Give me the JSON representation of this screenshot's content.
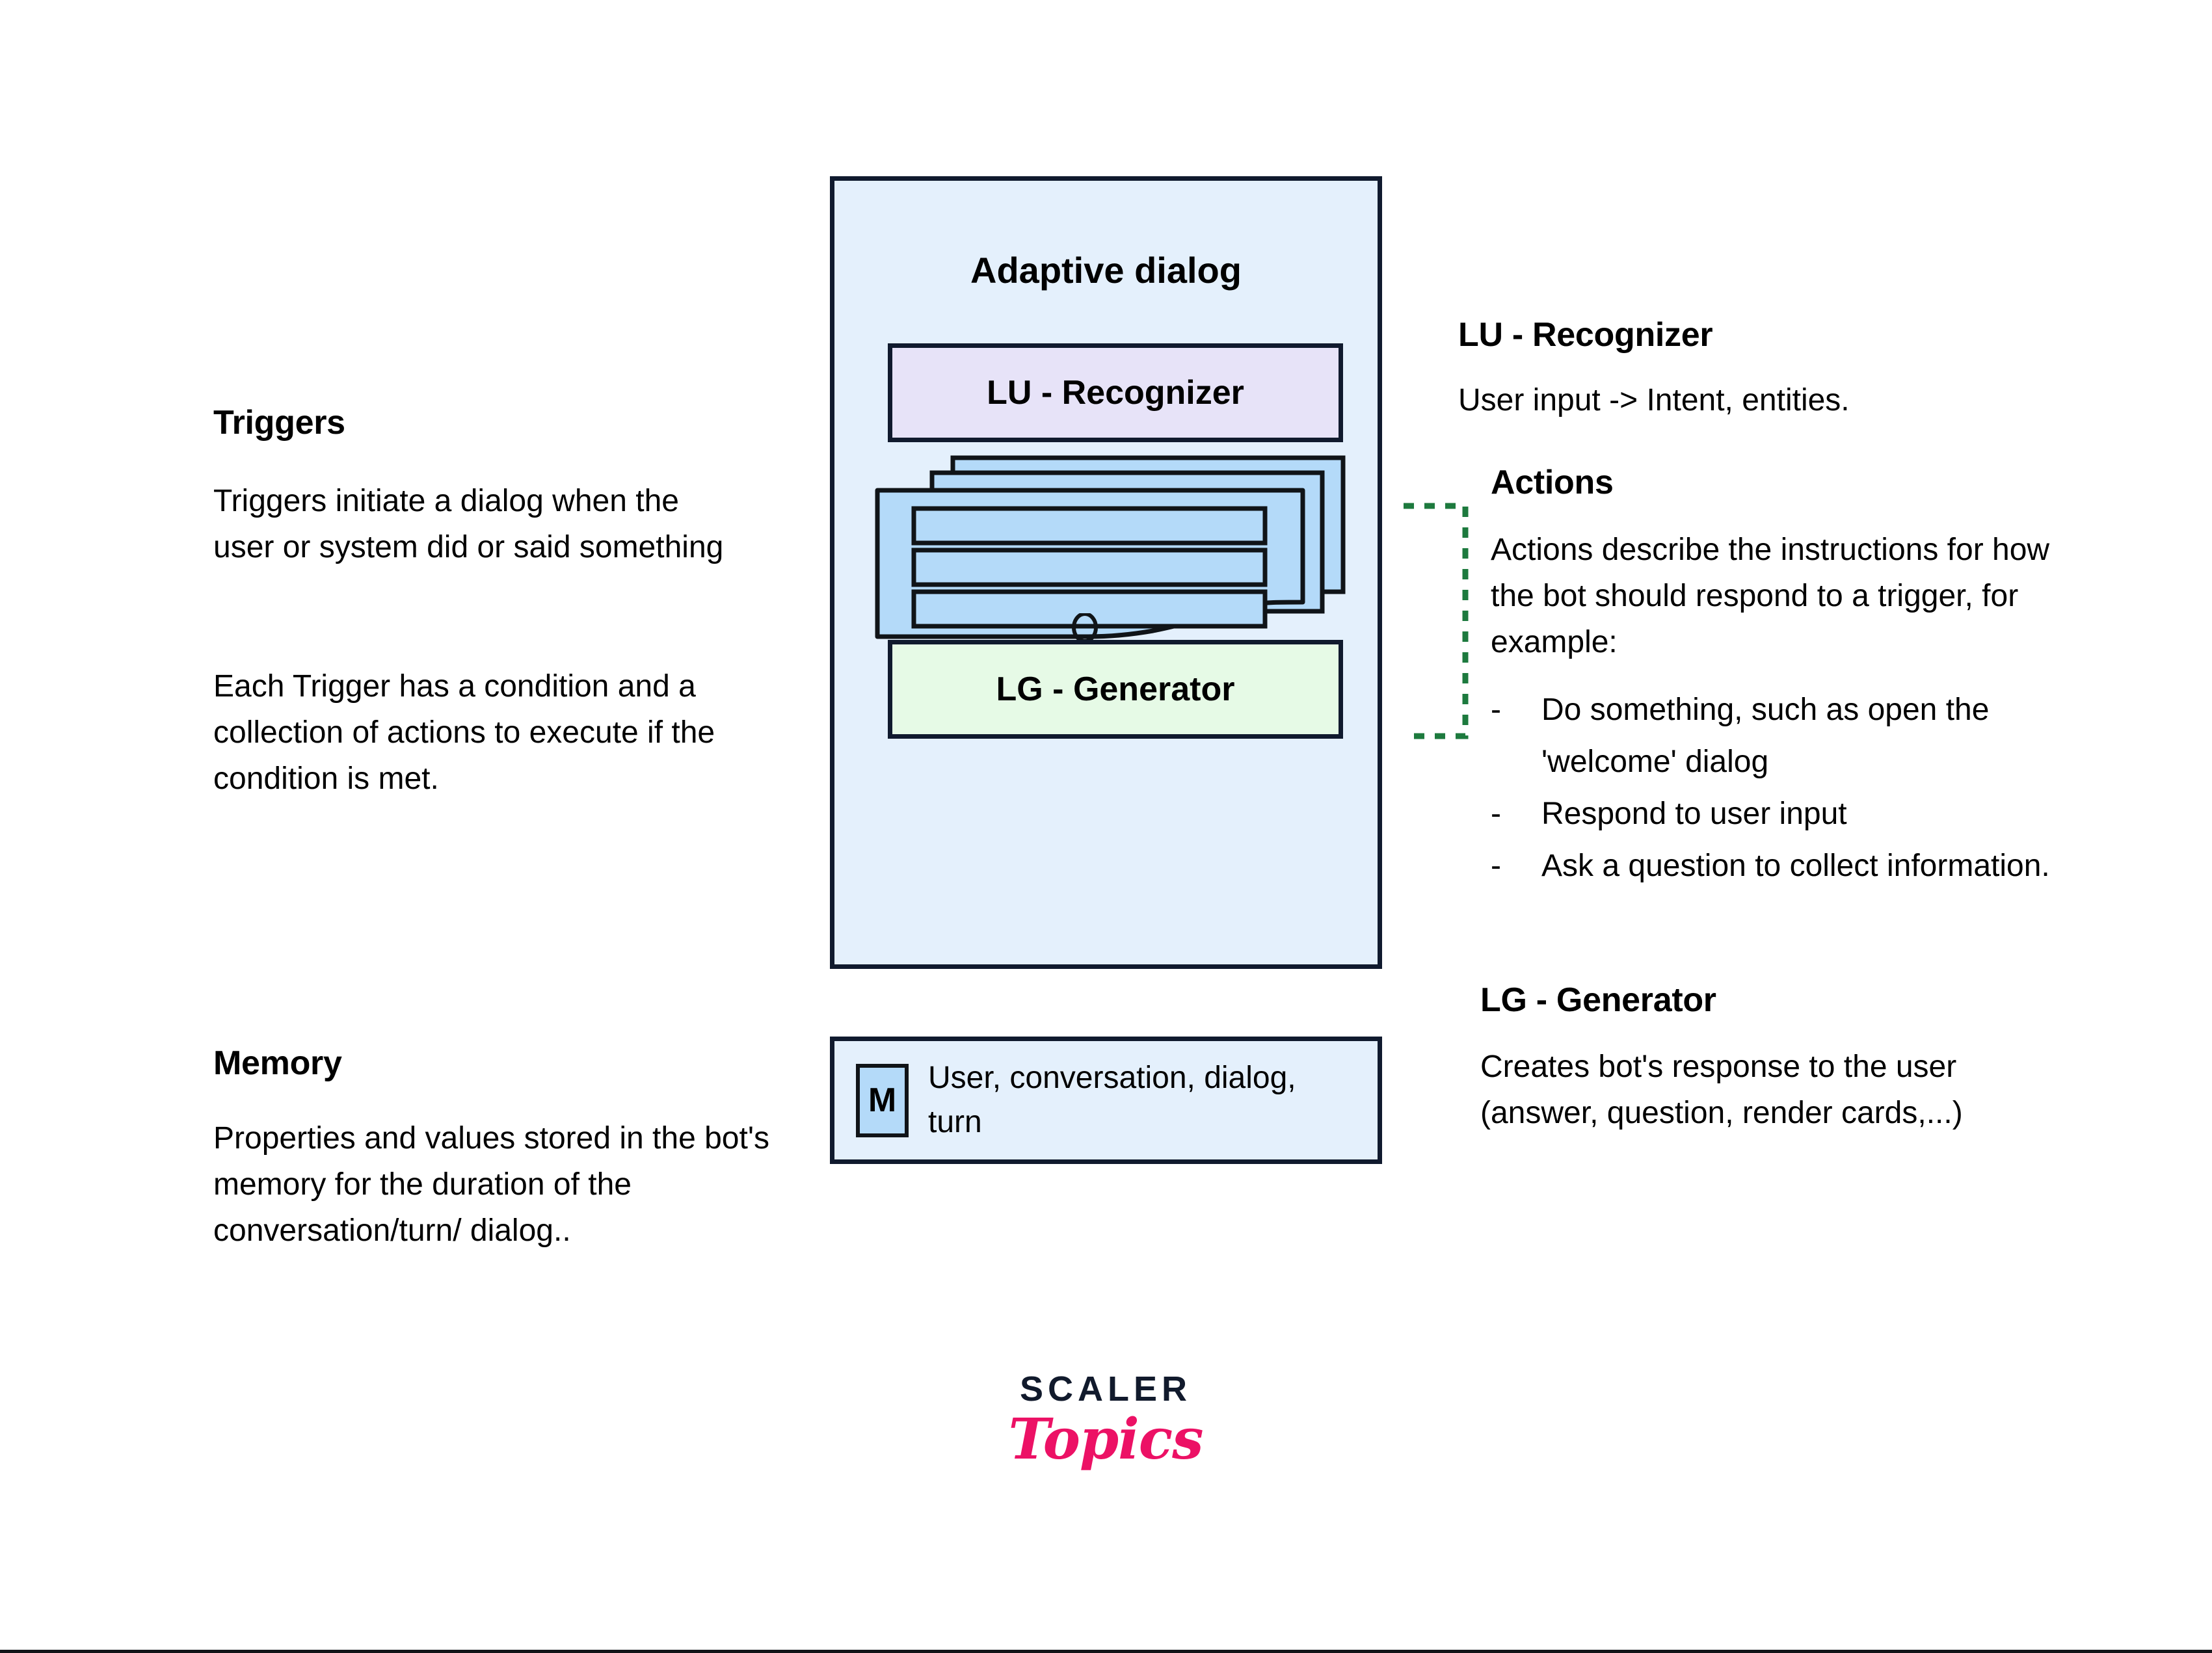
{
  "left_column": {
    "triggers": {
      "heading": "Triggers",
      "paragraph1": "Triggers initiate a dialog when the user or system did or said something",
      "paragraph2": "Each Trigger has a condition and a collection of actions to execute if the condition is met."
    },
    "memory": {
      "heading": "Memory",
      "paragraph1": "Properties and values stored in the bot's memory for the duration of the conversation/turn/ dialog.."
    }
  },
  "center": {
    "container_title": "Adaptive dialog",
    "lu_box_label": "LU - Recognizer",
    "lg_box_label": "LG - Generator",
    "memory_strip": {
      "chip_label": "M",
      "text": "User, conversation, dialog, turn"
    }
  },
  "right_column": {
    "lu": {
      "heading": "LU - Recognizer",
      "paragraph1": "User input -> Intent, entities."
    },
    "actions": {
      "heading": "Actions",
      "paragraph1": "Actions describe the instructions for how the bot should respond to a trigger, for example:",
      "bullet_marker": "-",
      "items": [
        "Do something, such as open the 'welcome' dialog",
        "Respond to user input",
        "Ask a question to collect information."
      ]
    },
    "lg": {
      "heading": "LG - Generator",
      "paragraph1": "Creates bot's response to the user (answer, question, render cards,...)"
    }
  },
  "logo": {
    "wordmark": "SCALER",
    "script": "Topics"
  },
  "colors": {
    "container_fill": "#e4f0fc",
    "lu_fill": "#e7e3f8",
    "lg_fill": "#e6fae6",
    "card_fill": "#b4daf9",
    "stroke": "#101a2e",
    "connector": "#1d7a3e",
    "logo_dark": "#111a2c",
    "logo_pink": "#ec1165"
  }
}
